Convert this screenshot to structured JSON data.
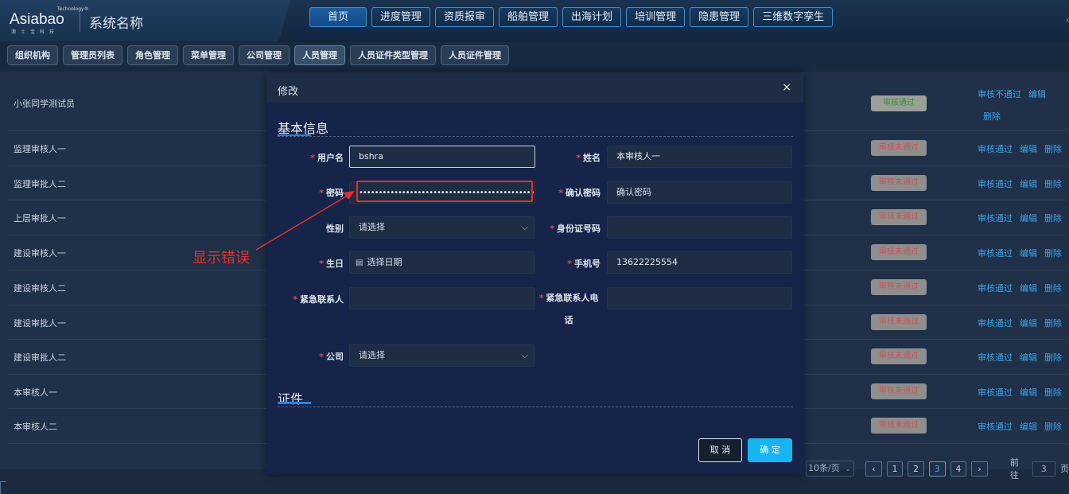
{
  "header": {
    "logo_tech": "Technology®",
    "logo_text": "Asiabao",
    "logo_sub": "澳士宝科技",
    "system_name": "系统名称",
    "nav": [
      "首页",
      "进度管理",
      "资质报审",
      "船舶管理",
      "出海计划",
      "培训管理",
      "隐患管理",
      "三维数字孪生"
    ],
    "active_nav": "首页"
  },
  "sub_nav": {
    "tabs": [
      "组织机构",
      "管理员列表",
      "角色管理",
      "菜单管理",
      "公司管理",
      "人员管理",
      "人员证件类型管理",
      "人员证件管理"
    ],
    "active_tab": "人员管理"
  },
  "table": {
    "rows": [
      {
        "name": "小张同学测试员",
        "status": "审核通过",
        "actions": [
          "审核不通过",
          "编辑",
          "删除"
        ]
      },
      {
        "name": "监理审核人一",
        "status": "审核未通过",
        "actions": [
          "审核通过",
          "编辑",
          "删除"
        ]
      },
      {
        "name": "监理审批人二",
        "status": "审核未通过",
        "actions": [
          "审核通过",
          "编辑",
          "删除"
        ]
      },
      {
        "name": "上层审批人一",
        "status": "审核未通过",
        "actions": [
          "审核通过",
          "编辑",
          "删除"
        ]
      },
      {
        "name": "建设审核人一",
        "status": "审核未通过",
        "actions": [
          "审核通过",
          "编辑",
          "删除"
        ]
      },
      {
        "name": "建设审核人二",
        "status": "审核未通过",
        "actions": [
          "审核通过",
          "编辑",
          "删除"
        ]
      },
      {
        "name": "建设审批人一",
        "status": "审核未通过",
        "actions": [
          "审核通过",
          "编辑",
          "删除"
        ]
      },
      {
        "name": "建设审批人二",
        "status": "审核未通过",
        "actions": [
          "审核通过",
          "编辑",
          "删除"
        ]
      },
      {
        "name": "本审核人一",
        "status": "审核未通过",
        "actions": [
          "审核通过",
          "编辑",
          "删除"
        ]
      },
      {
        "name": "本审核人二",
        "status": "审核未通过",
        "actions": [
          "审核通过",
          "编辑",
          "删除"
        ]
      }
    ]
  },
  "pagination": {
    "page_size": "10条/页",
    "prev": "‹",
    "pages": [
      "1",
      "2",
      "3",
      "4"
    ],
    "current_page": "3",
    "next": "›",
    "goto_label": "前往",
    "goto_value": "3",
    "goto_suffix": "页"
  },
  "modal": {
    "title": "修改",
    "close": "×",
    "section_basic": "基本信息",
    "section_cert": "证件",
    "fields": {
      "username": {
        "label": "用户名",
        "value": "bshra"
      },
      "name": {
        "label": "姓名",
        "value": "本审核人一"
      },
      "password": {
        "label": "密码",
        "value": "•••••••••••••••••••••••••••••••••••••••••••••••••••••"
      },
      "confirm_password": {
        "label": "确认密码",
        "placeholder": "确认密码"
      },
      "gender": {
        "label": "性别",
        "placeholder": "请选择"
      },
      "id_number": {
        "label": "身份证号码",
        "value": ""
      },
      "birthday": {
        "label": "生日",
        "placeholder": "选择日期"
      },
      "phone": {
        "label": "手机号",
        "value": "13622225554"
      },
      "emergency_contact": {
        "label": "紧急联系人",
        "value": ""
      },
      "emergency_phone": {
        "label_line1": "紧急联系人电",
        "label_line2": "话",
        "value": ""
      },
      "company": {
        "label": "公司",
        "placeholder": "请选择"
      }
    },
    "cancel": "取 消",
    "confirm": "确 定"
  },
  "annotation": {
    "text": "显示错误",
    "color": "#e0312f"
  }
}
